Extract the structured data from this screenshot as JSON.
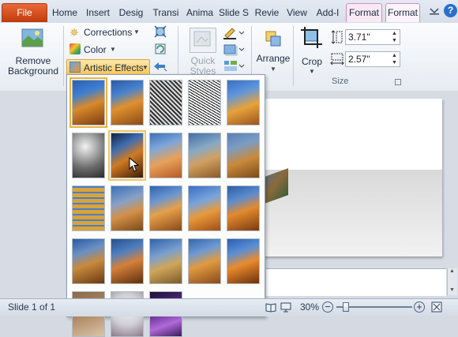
{
  "tabs": [
    {
      "label": "File"
    },
    {
      "label": "Home"
    },
    {
      "label": "Insert"
    },
    {
      "label": "Desig"
    },
    {
      "label": "Transi"
    },
    {
      "label": "Anima"
    },
    {
      "label": "Slide S"
    },
    {
      "label": "Revie"
    },
    {
      "label": "View"
    },
    {
      "label": "Add-I"
    },
    {
      "label": "Format"
    },
    {
      "label": "Format"
    }
  ],
  "ribbon": {
    "remove_background": "Remove Background",
    "corrections": "Corrections",
    "color": "Color",
    "artistic_effects": "Artistic Effects",
    "quick_styles": "Quick Styles",
    "arrange": "Arrange",
    "crop": "Crop",
    "height_value": "3.71\"",
    "width_value": "2.57\"",
    "size_group": "Size"
  },
  "status": {
    "slide_info": "Slide 1 of 1",
    "zoom": "30%"
  },
  "icons": {
    "help": "help-icon",
    "minimize_ribbon": "minimize-ribbon-icon",
    "cursor": "mouse-cursor-icon"
  },
  "colors": {
    "file_tab": "#c94a17",
    "context_tab_border": "#d88bc5",
    "selection": "#e8b43d",
    "help_circle": "#2a6fcb"
  }
}
